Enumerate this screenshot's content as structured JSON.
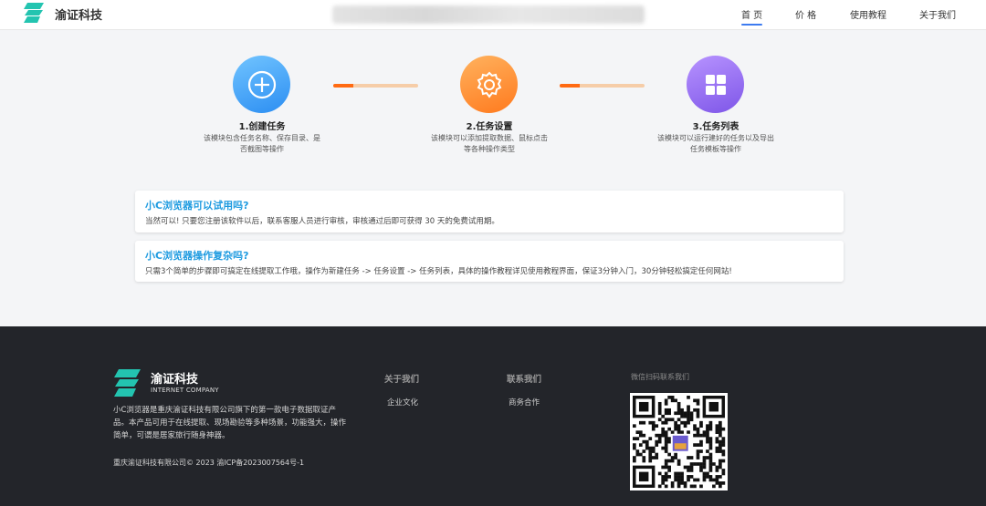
{
  "header": {
    "brand": "渝证科技",
    "nav": [
      {
        "label": "首 页",
        "active": true
      },
      {
        "label": "价 格",
        "active": false
      },
      {
        "label": "使用教程",
        "active": false
      },
      {
        "label": "关于我们",
        "active": false
      }
    ]
  },
  "steps": [
    {
      "icon": "plus-circle-icon",
      "title": "1.创建任务",
      "desc": "该模块包含任务名称、保存目录、是否截图等操作"
    },
    {
      "icon": "gear-icon",
      "title": "2.任务设置",
      "desc": "该模块可以添加提取数据、鼠标点击等各种操作类型"
    },
    {
      "icon": "grid-icon",
      "title": "3.任务列表",
      "desc": "该模块可以运行建好的任务以及导出任务模板等操作"
    }
  ],
  "faq": [
    {
      "question": "小C浏览器可以试用吗?",
      "answer": "当然可以! 只要您注册该软件以后，联系客服人员进行审核，审核通过后即可获得 30 天的免费试用期。"
    },
    {
      "question": "小C浏览器操作复杂吗?",
      "answer": "只需3个简单的步骤即可搞定在线提取工作哦，操作为新建任务 -> 任务设置 -> 任务列表，具体的操作教程详见使用教程界面，保证3分钟入门，30分钟轻松搞定任何网站!"
    }
  ],
  "footer": {
    "brand": "渝证科技",
    "subtitle": "INTERNET COMPANY",
    "description": "小C浏览器是重庆渝证科技有限公司旗下的第一款电子数据取证产品。本产品可用于在线提取、现场勘验等多种场景，功能强大，操作简单，可谓是居家旅行随身神器。",
    "copyright": "重庆渝证科技有限公司© 2023 渝ICP备2023007564号-1",
    "columns": [
      {
        "heading": "关于我们",
        "link": "企业文化"
      },
      {
        "heading": "联系我们",
        "link": "商务合作"
      }
    ],
    "qr_title": "微信扫码联系我们"
  },
  "colors": {
    "accent": "#1f9be0",
    "nav_underline": "#3d7bf0",
    "progress": "#ff6a12",
    "footer_bg": "#23252a"
  },
  "progress": [
    0.24,
    0.24
  ]
}
